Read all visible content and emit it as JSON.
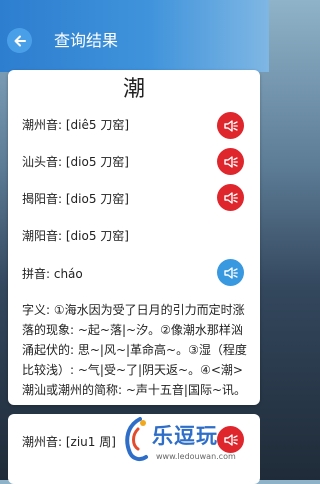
{
  "header": {
    "title": "查询结果"
  },
  "entry": {
    "character": "潮",
    "readings": [
      {
        "label": "潮州音: [diê5 刀窑]"
      },
      {
        "label": "汕头音: [dio5 刀窑]"
      },
      {
        "label": "揭阳音: [dio5 刀窑]"
      },
      {
        "label": "潮阳音: [dio5 刀窑]"
      }
    ],
    "pinyin": "拼音: cháo",
    "definition": "字义: ①海水因为受了日月的引力而定时涨落的现象: ~起~落|~汐。②像潮水那样汹涌起伏的: 思~|风~|革命高~。③湿（程度比较浅）: ~气|受~了|阴天返~。④<潮>潮汕或潮州的简称: ~声十五音|国际~讯。"
  },
  "next_entry": {
    "reading": "潮州音: [ziu1 周]"
  },
  "watermark": {
    "brand": "乐逗玩",
    "url": "www.ledouwan.com"
  },
  "colors": {
    "appbar": "#3f93db",
    "speaker_red": "#e0262d",
    "speaker_blue": "#3898e0"
  },
  "icons": {
    "back": "arrow-left-icon",
    "speaker": "speaker-icon"
  }
}
